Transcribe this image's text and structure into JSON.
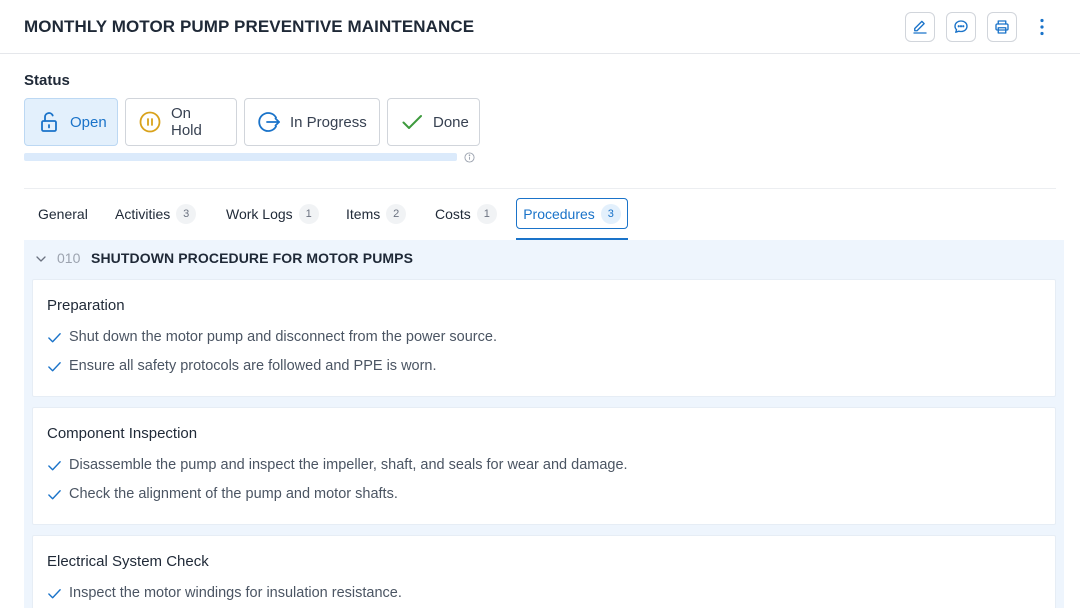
{
  "header": {
    "title": "MONTHLY MOTOR PUMP PREVENTIVE MAINTENANCE",
    "actions": [
      "edit-icon",
      "comments-icon",
      "print-icon",
      "more-vertical-icon"
    ]
  },
  "status": {
    "label": "Status",
    "options": [
      {
        "label": "Open",
        "icon": "unlock-icon",
        "active": true
      },
      {
        "label": "On Hold",
        "icon": "pause-circle-icon",
        "active": false
      },
      {
        "label": "In Progress",
        "icon": "arrow-right-circle-icon",
        "active": false
      },
      {
        "label": "Done",
        "icon": "check-icon",
        "active": false
      }
    ],
    "progress": 0
  },
  "tabs": [
    {
      "label": "General",
      "count": null,
      "active": false
    },
    {
      "label": "Activities",
      "count": "3",
      "active": false
    },
    {
      "label": "Work Logs",
      "count": "1",
      "active": false
    },
    {
      "label": "Items",
      "count": "2",
      "active": false
    },
    {
      "label": "Costs",
      "count": "1",
      "active": false
    },
    {
      "label": "Procedures",
      "count": "3",
      "active": true
    }
  ],
  "procedure": {
    "code": "010",
    "title": "SHUTDOWN PROCEDURE FOR MOTOR PUMPS",
    "sections": [
      {
        "title": "Preparation",
        "steps": [
          "Shut down the motor pump and disconnect from the power source.",
          "Ensure all safety protocols are followed and PPE is worn."
        ]
      },
      {
        "title": "Component Inspection",
        "steps": [
          "Disassemble the pump and inspect the impeller, shaft, and seals for wear and damage.",
          "Check the alignment of the pump and motor shafts."
        ]
      },
      {
        "title": "Electrical System Check",
        "steps": [
          "Inspect the motor windings for insulation resistance."
        ]
      }
    ]
  },
  "colors": {
    "accent": "#1a73c9",
    "accent_light": "#e3f0fc",
    "hold": "#d9a21b",
    "done": "#3d9a3d",
    "panel_bg": "#eef5fd"
  }
}
